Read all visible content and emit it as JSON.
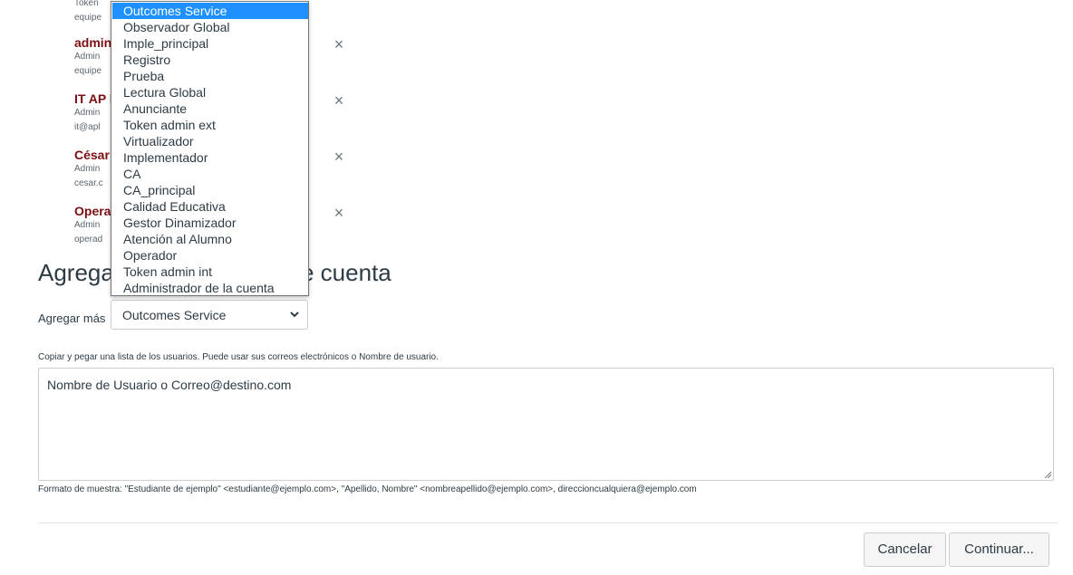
{
  "admins": [
    {
      "name": "",
      "line1": "Token",
      "line2": "equipe"
    },
    {
      "name": "admin",
      "line1": "Admin",
      "line2": "equipe"
    },
    {
      "name": "IT AP L",
      "line1": "Admin",
      "line2": "it@apl"
    },
    {
      "name": "César (",
      "line1": "Admin",
      "line2": "cesar.c"
    },
    {
      "name": "Opera",
      "line1": "Admin",
      "line2": "operad"
    }
  ],
  "remove_icon": "×",
  "section": {
    "heading_start": "Agrega",
    "heading_end": "e cuenta"
  },
  "role_select": {
    "label": "Agregar más",
    "value": "Outcomes Service",
    "options": [
      "Outcomes Service",
      "Observador Global",
      "Imple_principal",
      "Registro",
      "Prueba",
      "Lectura Global",
      "Anunciante",
      "Token admin ext",
      "Virtualizador",
      "Implementador",
      "CA",
      "CA_principal",
      "Calidad Educativa",
      "Gestor Dinamizador",
      "Atención al Alumno",
      "Operador",
      "Token admin int",
      "Administrador de la cuenta"
    ]
  },
  "users": {
    "hint": "Copiar y pegar una lista de los usuarios. Puede usar sus correos electrónicos o Nombre de usuario.",
    "placeholder": "Nombre de Usuario o Correo@destino.com",
    "format": "Formato de muestra: \"Estudiante de ejemplo\" <estudiante@ejemplo.com>, \"Apellido, Nombre\" <nombreapellido@ejemplo.com>, direccioncualquiera@ejemplo.com"
  },
  "buttons": {
    "cancel": "Cancelar",
    "continue": "Continuar..."
  },
  "icons": {
    "remove": "close-icon",
    "select": "chevron-down-icon",
    "resize": "resize-handle-icon"
  },
  "colors": {
    "admin_name": "#7a0f13",
    "selected_option": "#1e90ff"
  }
}
